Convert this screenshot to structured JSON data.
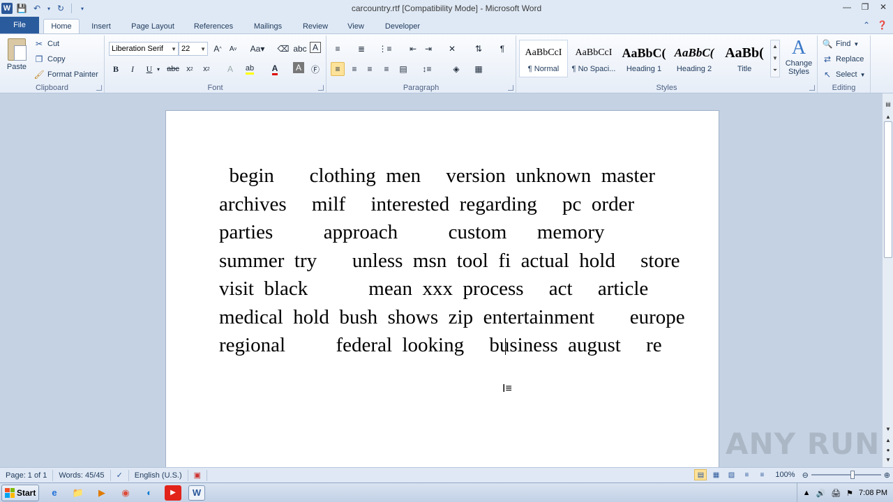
{
  "window": {
    "title": "carcountry.rtf [Compatibility Mode] - Microsoft Word"
  },
  "tabs": [
    "File",
    "Home",
    "Insert",
    "Page Layout",
    "References",
    "Mailings",
    "Review",
    "View",
    "Developer"
  ],
  "clipboard": {
    "paste": "Paste",
    "cut": "Cut",
    "copy": "Copy",
    "format_painter": "Format Painter",
    "label": "Clipboard"
  },
  "font": {
    "name": "Liberation Serif",
    "size": "22",
    "label": "Font"
  },
  "paragraph": {
    "label": "Paragraph"
  },
  "styles": {
    "items": [
      {
        "sample": "AaBbCcI",
        "name": "¶ Normal"
      },
      {
        "sample": "AaBbCcI",
        "name": "¶ No Spaci..."
      },
      {
        "sample": "AaBbC(",
        "name": "Heading 1"
      },
      {
        "sample": "AaBbC(",
        "name": "Heading 2"
      },
      {
        "sample": "AaBb(",
        "name": "Title"
      }
    ],
    "change_styles": "Change Styles",
    "label": "Styles"
  },
  "editing": {
    "find": "Find",
    "replace": "Replace",
    "select": "Select",
    "label": "Editing"
  },
  "document": {
    "lines": [
      "  begin       clothing  men     version  unknown  master",
      "archives     milf     interested  regarding     pc  order",
      "parties          approach          custom      memory",
      "summer  try       unless  msn  tool  fi  actual  hold     store",
      "visit  black            mean  xxx  process     act     article",
      "medical  hold  bush  shows  zip  entertainment       europe",
      "regional          federal  looking     business  august     re"
    ]
  },
  "status": {
    "page": "Page: 1 of 1",
    "words": "Words: 45/45",
    "language": "English (U.S.)",
    "zoom": "100%"
  },
  "watermark": "ANY RUN",
  "taskbar": {
    "start": "Start",
    "clock": "7:08 PM"
  }
}
